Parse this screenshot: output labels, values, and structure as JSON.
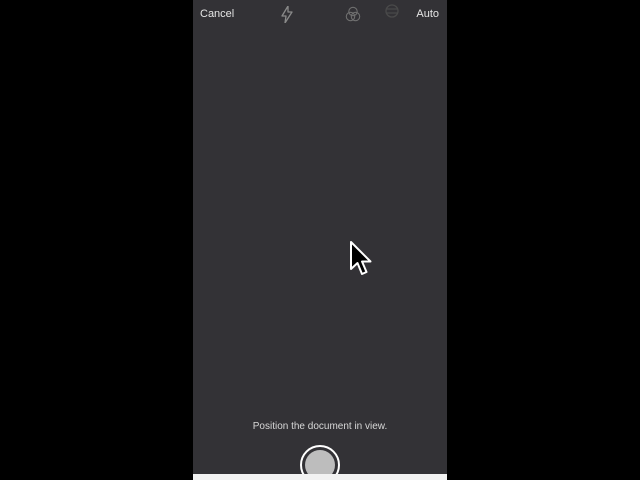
{
  "topbar": {
    "cancel_label": "Cancel",
    "auto_label": "Auto"
  },
  "icons": {
    "flash": "flash-icon",
    "filter": "filter-icon",
    "rotate": "rotate-icon",
    "cursor": "mouse-pointer-icon"
  },
  "viewfinder": {
    "hint_text": "Position the document in view."
  },
  "colors": {
    "viewfinder_bg": "#333236",
    "outer_bg": "#000000",
    "text": "#e6e6e6"
  }
}
